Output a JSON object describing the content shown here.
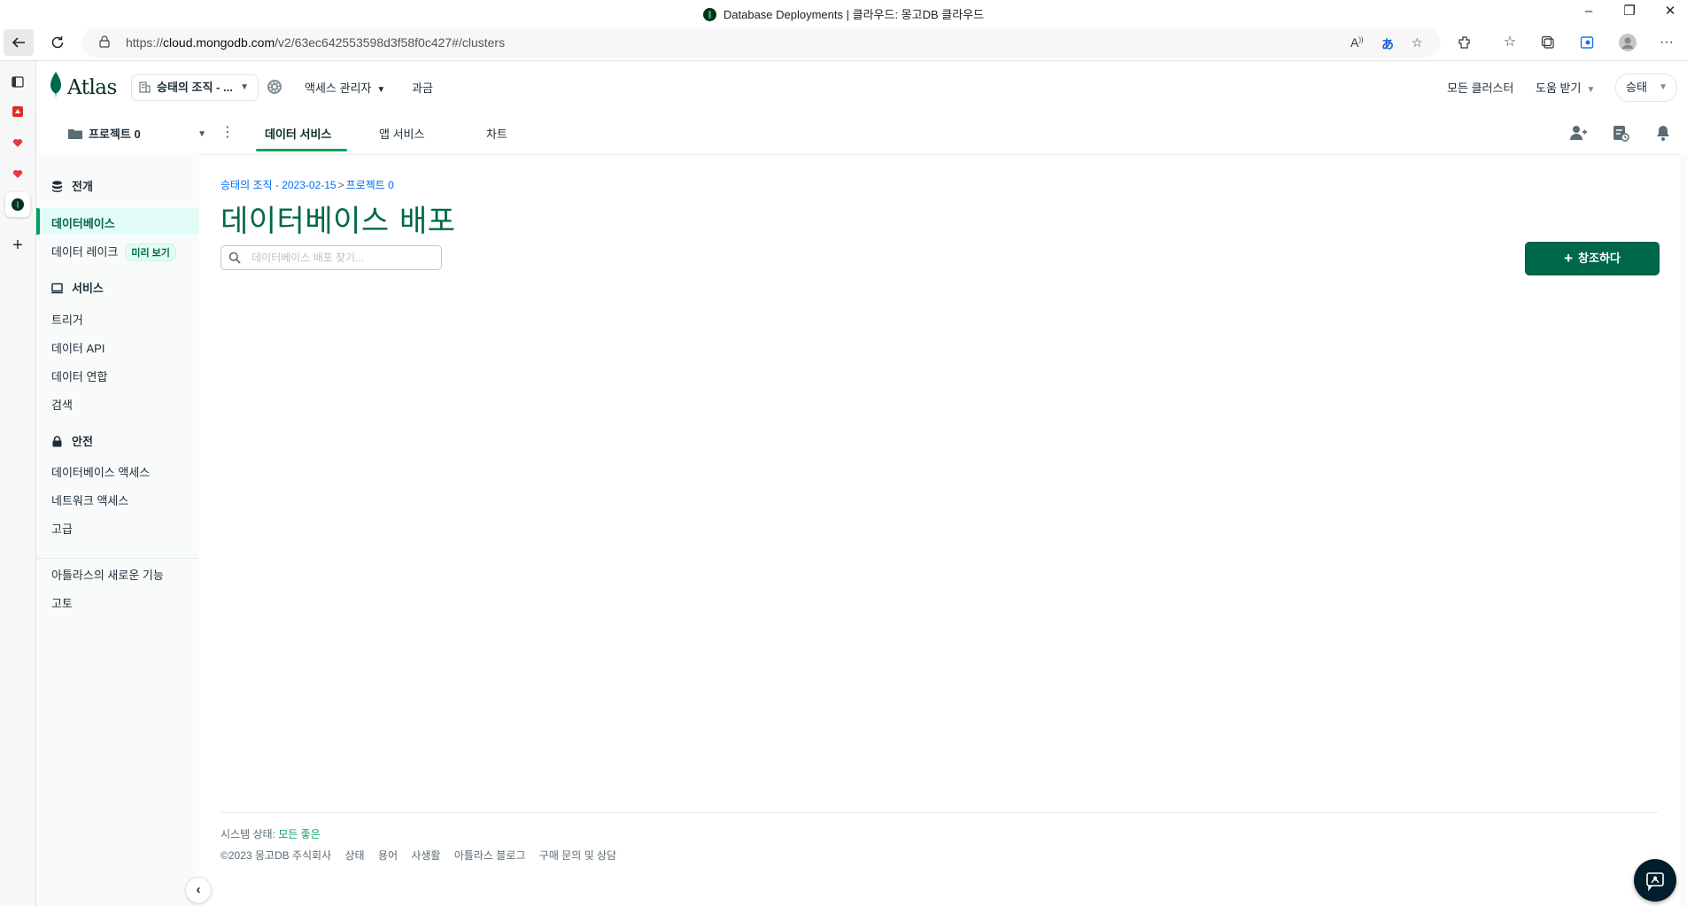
{
  "window": {
    "title": "Database Deployments | 클라우드: 몽고DB 클라우드",
    "minimize": "–",
    "restore": "❐",
    "close": "✕"
  },
  "browser": {
    "url_prefix": "https://",
    "url_host": "cloud.mongodb.com",
    "url_path": "/v2/63ec642553598d3f58f0c427#/clusters",
    "more_label": "···"
  },
  "atlas": {
    "logo_text": "Atlas",
    "org_name": "승태의 조직 - ...",
    "access_manager": "액세스 관리자",
    "billing": "과금",
    "all_clusters": "모든 클러스터",
    "get_help": "도움 받기",
    "user_menu": "승태"
  },
  "project": {
    "name": "프로젝트 0",
    "tabs": [
      {
        "label": "데이터 서비스",
        "active": true
      },
      {
        "label": "앱 서비스",
        "active": false
      },
      {
        "label": "차트",
        "active": false
      }
    ]
  },
  "leftnav": {
    "deployment_head": "전개",
    "database": "데이터베이스",
    "data_lake": "데이터 레이크",
    "preview_badge": "미리 보기",
    "services_head": "서비스",
    "triggers": "트리거",
    "data_api": "데이터 API",
    "data_federation": "데이터 연합",
    "search": "검색",
    "security_head": "안전",
    "database_access": "데이터베이스 액세스",
    "network_access": "네트워크 액세스",
    "advanced": "고급",
    "whats_new": "아틀라스의 새로운 기능",
    "goto": "고토"
  },
  "main": {
    "breadcrumb_org": "승태의 조직 - 2023-02-15",
    "breadcrumb_sep": ">",
    "breadcrumb_project": "프로젝트 0",
    "title": "데이터베이스 배포",
    "search_placeholder": "데이터베이스 배포 찾기...",
    "create_button": "창조하다"
  },
  "footer": {
    "status_label": "시스템 상태:",
    "status_value": "모든 좋은",
    "copyright": "©2023 몽고DB 주식회사",
    "links": [
      "상태",
      "용어",
      "사생활",
      "아틀라스 블로그",
      "구매 문의 및 상담"
    ]
  },
  "colors": {
    "brand_green": "#00684a",
    "accent_green": "#00a35c",
    "link_blue": "#016bf8",
    "dark": "#001e2b"
  }
}
